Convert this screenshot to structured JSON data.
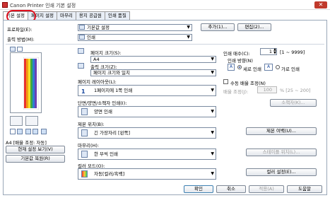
{
  "window": {
    "title": "Canon Printer 인쇄 기본 설정",
    "close": "✕"
  },
  "tabs": [
    "기본 설정",
    "페이지 설정",
    "마무리",
    "용지 공급원",
    "인쇄 품질"
  ],
  "profile": {
    "label": "프로파일(E):",
    "value": "기본값 설정",
    "add": "추가(1)...",
    "edit": "편집(2)..."
  },
  "output": {
    "label": "출력 방법(M):",
    "value": "인쇄"
  },
  "page_size": {
    "label": "페이지 크기(S):",
    "value": "A4"
  },
  "output_size": {
    "label": "출력 크기(Z):",
    "value": "페이지 크기와 일치"
  },
  "layout": {
    "label": "페이지 레이아웃(L):",
    "value": "1페이지에 1쪽 인쇄"
  },
  "duplex": {
    "label": "단면/양면/소책자 인쇄(I):",
    "value": "양면 인쇄"
  },
  "binding": {
    "label": "제본 위치(B):",
    "value": "긴 가장자리 [왼쪽]"
  },
  "finishing": {
    "label": "마무리(H):",
    "value": "한 부씩 인쇄"
  },
  "color": {
    "label": "컬러 모드(O):",
    "value": "자동[컬러/흑백]"
  },
  "copies": {
    "label": "인쇄 매수(C):",
    "value": "1",
    "range": "[1 ~ 9999]"
  },
  "orientation": {
    "label": "인쇄 방향(N)",
    "portrait": "세로 인쇄",
    "landscape": "가로 인쇄"
  },
  "manual_scaling": {
    "label": "수동 배율 조정(N)",
    "scale_label": "배율 조정(J):",
    "scale_value": "100",
    "scale_range": "% [25 ~ 200]"
  },
  "booklet_btn": "소책자(K)...",
  "binding_margin_btn": "제본 여백(U)...",
  "staple_btn": "스테이플 위치(L)...",
  "color_settings_btn": "컬러 설정(E)...",
  "preview": {
    "caption": "A4 [배율 조정: 자동]",
    "view_settings": "현재 설정 보기(V)",
    "restore": "기본값 복원(R)"
  },
  "footer": {
    "ok": "확인",
    "cancel": "취소",
    "apply": "적용(A)",
    "help": "도움말"
  }
}
